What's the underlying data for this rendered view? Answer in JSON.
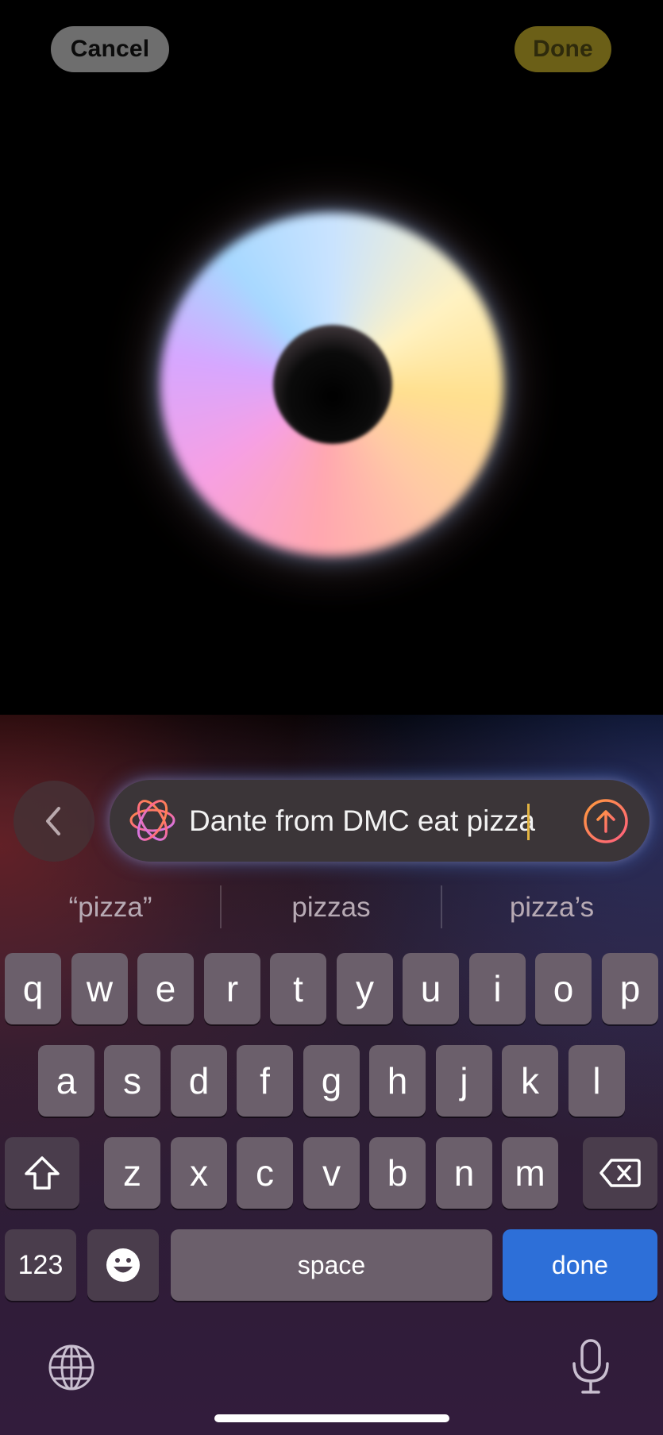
{
  "top_bar": {
    "cancel_label": "Cancel",
    "done_label": "Done"
  },
  "prompt": {
    "text": "Dante from DMC eat pizza",
    "back_icon": "chevron-left-icon",
    "ai_icon": "image-playground-icon",
    "send_icon": "arrow-up-circle-icon"
  },
  "suggestions": [
    "“pizza”",
    "pizzas",
    "pizza’s"
  ],
  "keyboard": {
    "row1": [
      "q",
      "w",
      "e",
      "r",
      "t",
      "y",
      "u",
      "i",
      "o",
      "p"
    ],
    "row2": [
      "a",
      "s",
      "d",
      "f",
      "g",
      "h",
      "j",
      "k",
      "l"
    ],
    "row3": [
      "z",
      "x",
      "c",
      "v",
      "b",
      "n",
      "m"
    ],
    "numbers_label": "123",
    "space_label": "space",
    "done_label": "done",
    "shift_icon": "shift-icon",
    "delete_icon": "delete-icon",
    "emoji_icon": "emoji-icon",
    "globe_icon": "globe-icon",
    "mic_icon": "microphone-icon"
  },
  "colors": {
    "done_key": "#2d6fd8",
    "done_top": "#6b5f17",
    "caret": "#e3b341"
  }
}
